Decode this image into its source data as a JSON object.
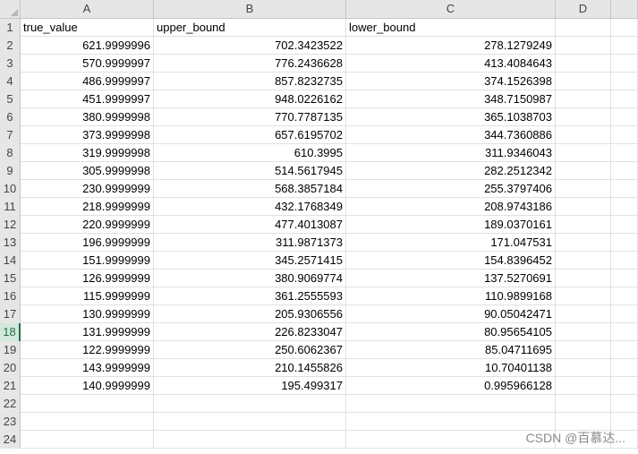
{
  "columns": [
    "A",
    "B",
    "C",
    "D"
  ],
  "header_row": {
    "row": "1",
    "A": "true_value",
    "B": "upper_bound",
    "C": "lower_bound"
  },
  "rows": [
    {
      "row": "2",
      "A": "621.9999996",
      "B": "702.3423522",
      "C": "278.1279249"
    },
    {
      "row": "3",
      "A": "570.9999997",
      "B": "776.2436628",
      "C": "413.4084643"
    },
    {
      "row": "4",
      "A": "486.9999997",
      "B": "857.8232735",
      "C": "374.1526398"
    },
    {
      "row": "5",
      "A": "451.9999997",
      "B": "948.0226162",
      "C": "348.7150987"
    },
    {
      "row": "6",
      "A": "380.9999998",
      "B": "770.7787135",
      "C": "365.1038703"
    },
    {
      "row": "7",
      "A": "373.9999998",
      "B": "657.6195702",
      "C": "344.7360886"
    },
    {
      "row": "8",
      "A": "319.9999998",
      "B": "610.3995",
      "C": "311.9346043"
    },
    {
      "row": "9",
      "A": "305.9999998",
      "B": "514.5617945",
      "C": "282.2512342"
    },
    {
      "row": "10",
      "A": "230.9999999",
      "B": "568.3857184",
      "C": "255.3797406"
    },
    {
      "row": "11",
      "A": "218.9999999",
      "B": "432.1768349",
      "C": "208.9743186"
    },
    {
      "row": "12",
      "A": "220.9999999",
      "B": "477.4013087",
      "C": "189.0370161"
    },
    {
      "row": "13",
      "A": "196.9999999",
      "B": "311.9871373",
      "C": "171.047531"
    },
    {
      "row": "14",
      "A": "151.9999999",
      "B": "345.2571415",
      "C": "154.8396452"
    },
    {
      "row": "15",
      "A": "126.9999999",
      "B": "380.9069774",
      "C": "137.5270691"
    },
    {
      "row": "16",
      "A": "115.9999999",
      "B": "361.2555593",
      "C": "110.9899168"
    },
    {
      "row": "17",
      "A": "130.9999999",
      "B": "205.9306556",
      "C": "90.05042471"
    },
    {
      "row": "18",
      "A": "131.9999999",
      "B": "226.8233047",
      "C": "80.95654105"
    },
    {
      "row": "19",
      "A": "122.9999999",
      "B": "250.6062367",
      "C": "85.04711695"
    },
    {
      "row": "20",
      "A": "143.9999999",
      "B": "210.1455826",
      "C": "10.70401138"
    },
    {
      "row": "21",
      "A": "140.9999999",
      "B": "195.499317",
      "C": "0.995966128"
    }
  ],
  "empty_rows": [
    "22",
    "23",
    "24"
  ],
  "selected_row": "18",
  "watermark": "CSDN @百慕达...",
  "colors": {
    "header_bg": "#e6e6e6",
    "grid": "#e1e1e1",
    "accent": "#217346"
  }
}
